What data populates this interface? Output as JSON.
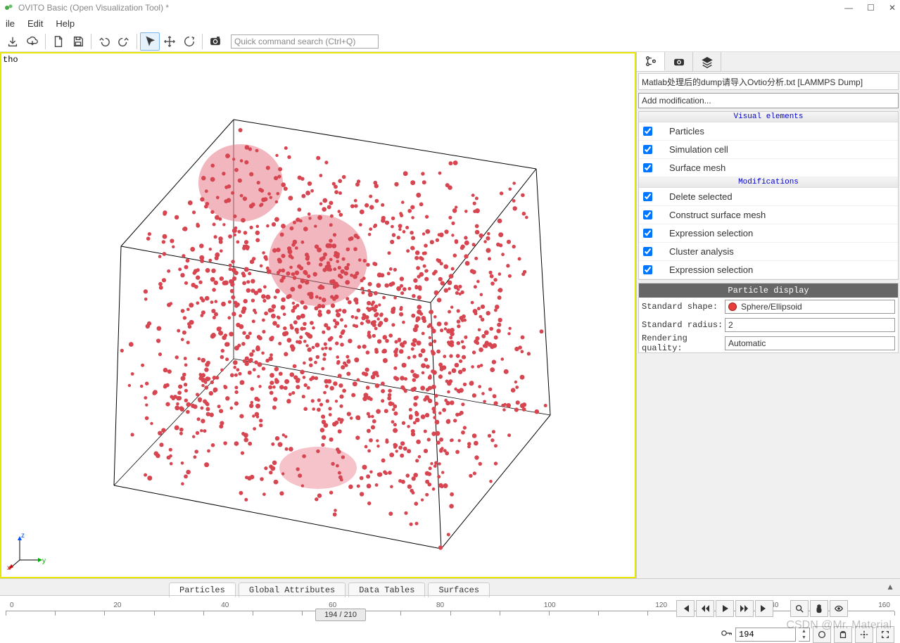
{
  "title": "OVITO Basic (Open Visualization Tool) *",
  "menu": {
    "file": "ile",
    "edit": "Edit",
    "help": "Help"
  },
  "search_placeholder": "Quick command search (Ctrl+Q)",
  "viewport": {
    "label": "tho",
    "axes": {
      "x": "x",
      "y": "y",
      "z": "z"
    }
  },
  "panel": {
    "file": "Matlab处理后的dump请导入Ovtio分析.txt [LAMMPS Dump]",
    "add_mod": "Add modification...",
    "section_visual": "Visual elements",
    "section_mods": "Modifications",
    "items": [
      {
        "label": "Particles",
        "checked": true
      },
      {
        "label": "Simulation cell",
        "checked": true
      },
      {
        "label": "Surface mesh",
        "checked": true
      }
    ],
    "mods": [
      {
        "label": "Delete selected",
        "checked": true
      },
      {
        "label": "Construct surface mesh",
        "checked": true
      },
      {
        "label": "Expression selection",
        "checked": true
      },
      {
        "label": "Cluster analysis",
        "checked": true
      },
      {
        "label": "Expression selection",
        "checked": true
      }
    ],
    "props": {
      "header": "Particle display",
      "shape_label": "Standard shape:",
      "shape_value": "Sphere/Ellipsoid",
      "radius_label": "Standard radius:",
      "radius_value": "2",
      "quality_label": "Rendering quality:",
      "quality_value": "Automatic"
    }
  },
  "bottom_tabs": [
    "Particles",
    "Global Attributes",
    "Data Tables",
    "Surfaces"
  ],
  "timeline": {
    "ticks": [
      "0",
      "20",
      "40",
      "60",
      "80",
      "100",
      "120",
      "140",
      "160"
    ],
    "thumb": "194 / 210",
    "frame": "194"
  },
  "watermark": "CSDN @Mr. Material"
}
